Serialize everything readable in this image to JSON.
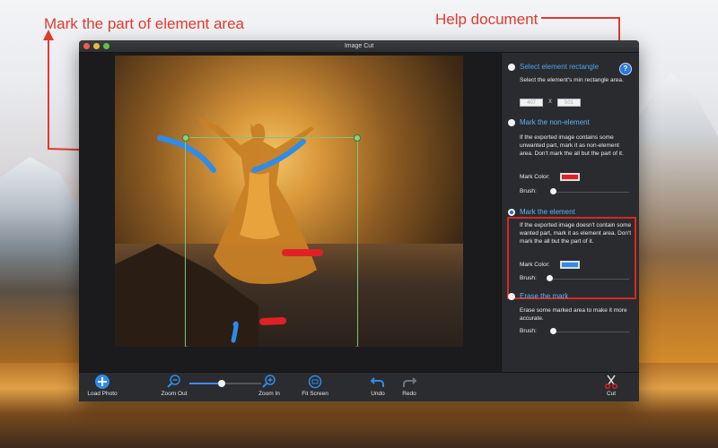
{
  "annotations": {
    "mark_part": "Mark the part of element area",
    "help_doc": "Help document"
  },
  "window": {
    "title": "Image Cut"
  },
  "panel": {
    "help_glyph": "?",
    "select_rect": {
      "title": "Select element rectangle",
      "desc": "Select the element's min rectangle area.",
      "width": "407",
      "sep": "X",
      "height": "501"
    },
    "non_element": {
      "title": "Mark the non-element",
      "desc": "If the exported image contains some unwanted part,  mark it as non-element area.  Don't mark the all but the part of it.",
      "color_label": "Mark Color:",
      "color": "#e02027",
      "brush_label": "Brush:",
      "brush_level": 0.12
    },
    "element": {
      "title": "Mark the element",
      "desc": "If the exported image doesn't contain some wanted part,  mark it as element area.  Don't mark the all but the part of it.",
      "color_label": "Mark Color:",
      "color": "#2f8ce8",
      "brush_label": "Brush:",
      "brush_level": 0.12
    },
    "erase": {
      "title": "Erase the mark",
      "desc": "Erase some marked area to make it more accurate.",
      "brush_label": "Brush:",
      "brush_level": 0.12
    }
  },
  "toolbar": {
    "load_photo": "Load Photo",
    "zoom_out": "Zoom Out",
    "zoom_in": "Zoom In",
    "fit_screen": "Fit Screen",
    "undo": "Undo",
    "redo": "Redo",
    "cut": "Cut",
    "zoom_level": 0.4
  }
}
